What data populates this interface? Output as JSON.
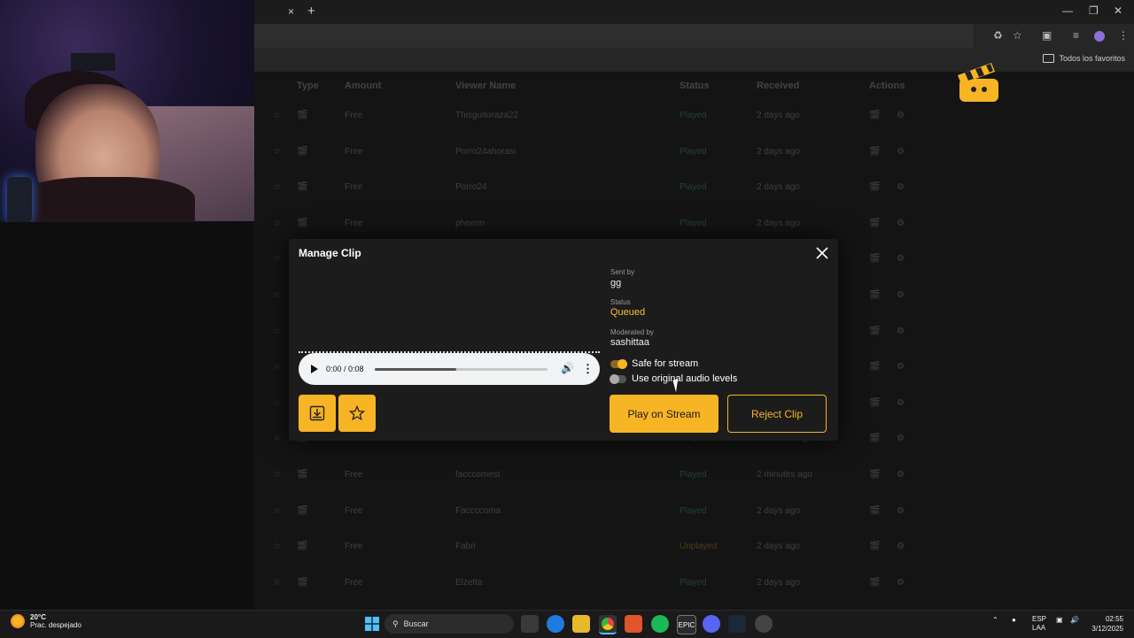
{
  "browser": {
    "tab_close": "×",
    "tab_new": "+",
    "bookmarks_label": "Todos los favoritos"
  },
  "table": {
    "headers": [
      "Type",
      "Amount",
      "Viewer Name",
      "Status",
      "Received",
      "Actions"
    ],
    "rows": [
      {
        "amount": "Free",
        "viewer": "Thisguitoraza22",
        "status": "Played",
        "received": "2 days ago"
      },
      {
        "amount": "Free",
        "viewer": "Porro24ahorasi",
        "status": "Played",
        "received": "2 days ago"
      },
      {
        "amount": "Free",
        "viewer": "Porro24",
        "status": "Played",
        "received": "2 days ago"
      },
      {
        "amount": "Free",
        "viewer": "pheenn",
        "status": "Played",
        "received": "2 days ago"
      },
      {
        "amount": "Free",
        "viewer": "",
        "status": "Played",
        "received": "2 days ago"
      },
      {
        "amount": "Free",
        "viewer": "",
        "status": "Played",
        "received": "2 days ago"
      },
      {
        "amount": "Free",
        "viewer": "",
        "status": "Played",
        "received": "2 days ago"
      },
      {
        "amount": "Free",
        "viewer": "",
        "status": "Played",
        "received": "2 days ago"
      },
      {
        "amount": "Free",
        "viewer": "",
        "status": "Played",
        "received": "2 days ago"
      },
      {
        "amount": "Free",
        "viewer": "facccomail",
        "status": "Played",
        "received": "2 minutes ago"
      },
      {
        "amount": "Free",
        "viewer": "facccomest",
        "status": "Played",
        "received": "2 minutes ago"
      },
      {
        "amount": "Free",
        "viewer": "Faccccoma",
        "status": "Played",
        "received": "2 days ago"
      },
      {
        "amount": "Free",
        "viewer": "Fabri",
        "status": "Unplayed",
        "received": "2 days ago"
      },
      {
        "amount": "Free",
        "viewer": "Elzetta",
        "status": "Played",
        "received": "2 days ago"
      }
    ]
  },
  "modal": {
    "title": "Manage Clip",
    "sent_by_label": "Sent by",
    "sent_by_value": "gg",
    "status_label": "Status",
    "status_value": "Queued",
    "moderated_label": "Moderated by",
    "moderated_value": "sashittaa",
    "audio_time": "0:00 / 0:08",
    "audio_progress": 0.47,
    "safe_label": "Safe for stream",
    "safe_on": true,
    "original_audio_label": "Use original audio levels",
    "original_audio_on": false,
    "play_button": "Play on Stream",
    "reject_button": "Reject Clip",
    "accent_color": "#f7b425"
  },
  "taskbar": {
    "temperature": "20°C",
    "weather": "Prac. despejado",
    "search_placeholder": "Buscar",
    "lang_top": "ESP",
    "lang_bottom": "LAA",
    "time": "02:55",
    "date": "3/12/2025",
    "epic_label": "EPIC"
  }
}
